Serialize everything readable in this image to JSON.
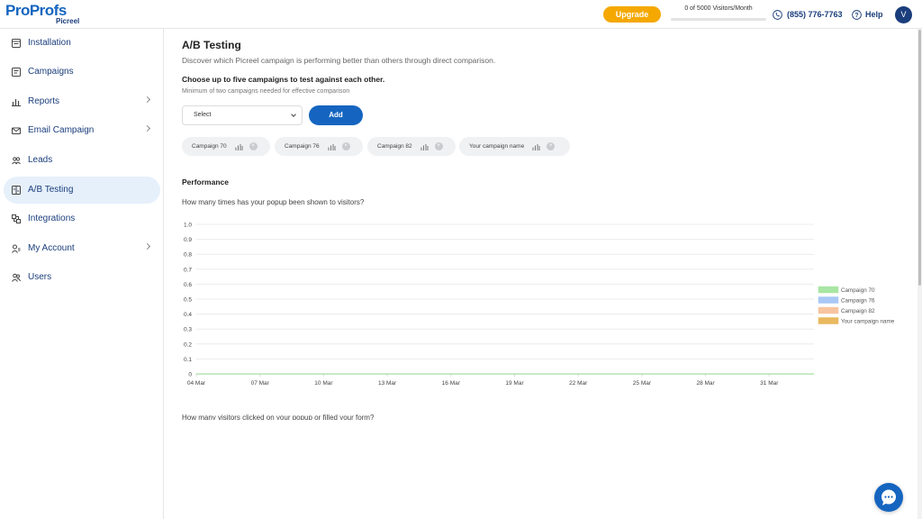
{
  "header": {
    "logo_main_pro": "Pro",
    "logo_main_profs": "Profs",
    "logo_sub": "Picreel",
    "upgrade_label": "Upgrade",
    "visitors_text": "0 of 5000 Visitors/Month",
    "visitors_progress": 0,
    "phone": "(855) 776-7763",
    "help": "Help",
    "avatar_initial": "V"
  },
  "sidebar": {
    "items": [
      {
        "label": "Installation",
        "icon": "installation-icon",
        "chevron": false
      },
      {
        "label": "Campaigns",
        "icon": "campaigns-icon",
        "chevron": false
      },
      {
        "label": "Reports",
        "icon": "reports-icon",
        "chevron": true
      },
      {
        "label": "Email Campaign",
        "icon": "email-icon",
        "chevron": true
      },
      {
        "label": "Leads",
        "icon": "leads-icon",
        "chevron": false
      },
      {
        "label": "A/B Testing",
        "icon": "ab-testing-icon",
        "chevron": false,
        "active": true
      },
      {
        "label": "Integrations",
        "icon": "integrations-icon",
        "chevron": false
      },
      {
        "label": "My Account",
        "icon": "account-icon",
        "chevron": true
      },
      {
        "label": "Users",
        "icon": "users-icon",
        "chevron": false
      }
    ]
  },
  "main": {
    "title": "A/B Testing",
    "description": "Discover which Picreel campaign is performing better than others through direct comparison.",
    "choose_heading": "Choose up to five campaigns to test against each other.",
    "min_note": "Minimum of two campaigns needed for effective comparison",
    "select_value": "Select",
    "add_label": "Add",
    "chips": [
      "Campaign 70",
      "Campaign 76",
      "Campaign 82",
      "Your campaign name"
    ],
    "performance_title": "Performance",
    "question_shown": "How many times has your popup been shown to visitors?",
    "question_clicked": "How many visitors clicked on your popup or filled your form?"
  },
  "colors": {
    "brand": "#1565c0",
    "upgrade": "#f5a800"
  },
  "chart_data": {
    "type": "area",
    "x": [
      "04 Mar",
      "07 Mar",
      "10 Mar",
      "13 Mar",
      "16 Mar",
      "19 Mar",
      "22 Mar",
      "25 Mar",
      "28 Mar",
      "31 Mar"
    ],
    "ylim": [
      0,
      1
    ],
    "yticks": [
      "1.0",
      "0.9",
      "0.8",
      "0.7",
      "0.6",
      "0.5",
      "0.4",
      "0.3",
      "0.2",
      "0.1",
      "0"
    ],
    "series": [
      {
        "name": "Campaign 70",
        "color": "#a8e6a3",
        "values": [
          0,
          0,
          0,
          0,
          0,
          0,
          0,
          0,
          0,
          0
        ]
      },
      {
        "name": "Campaign 76",
        "color": "#a9c8f5",
        "values": [
          0,
          0,
          0,
          0,
          0,
          0,
          0,
          0,
          0,
          0
        ]
      },
      {
        "name": "Campaign 82",
        "color": "#f7c59f",
        "values": [
          0,
          0,
          0,
          0,
          0,
          0,
          0,
          0,
          0,
          0
        ]
      },
      {
        "name": "Your campaign name",
        "color": "#e8b95e",
        "values": [
          0,
          0,
          0,
          0,
          0,
          0,
          0,
          0,
          0,
          0
        ]
      }
    ],
    "grid": true,
    "legend": "right"
  }
}
